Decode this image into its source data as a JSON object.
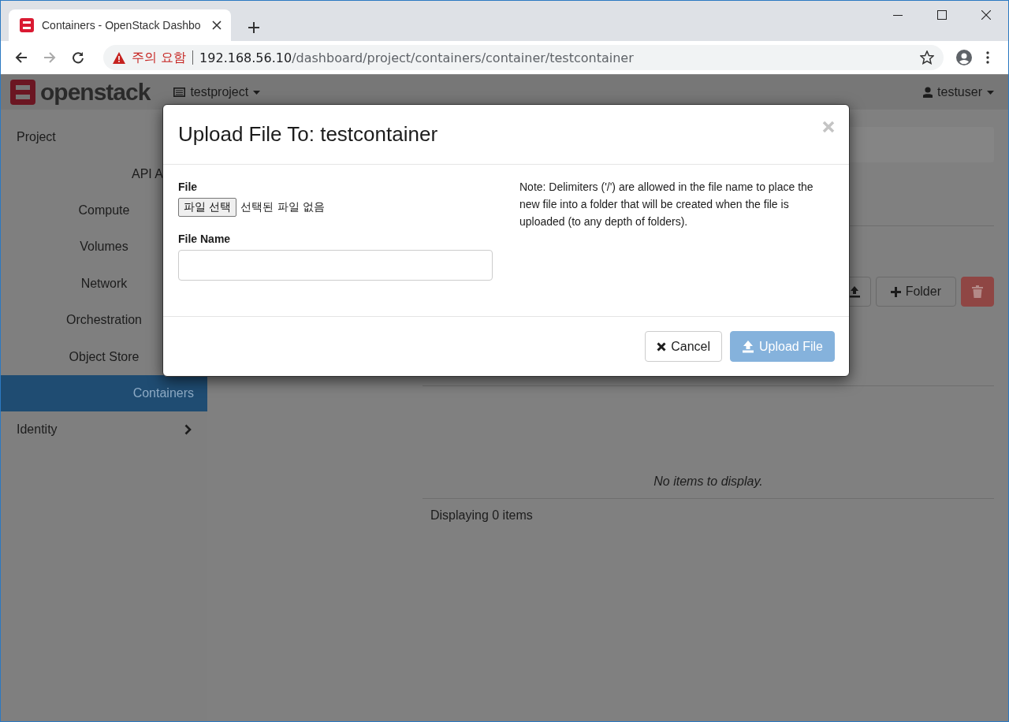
{
  "browser": {
    "tab_title": "Containers - OpenStack Dashbo",
    "security_label": "주의 요함",
    "url_host": "192.168.56.10",
    "url_path": "/dashboard/project/containers/container/testcontainer"
  },
  "navbar": {
    "logo_text": "openstack",
    "project": "testproject",
    "user": "testuser"
  },
  "sidebar": {
    "items": [
      {
        "label": "Project",
        "kind": "header",
        "selected": false
      },
      {
        "label": "API A",
        "kind": "link",
        "selected": false
      },
      {
        "label": "Compute",
        "kind": "section",
        "selected": false
      },
      {
        "label": "Volumes",
        "kind": "section",
        "selected": false
      },
      {
        "label": "Network",
        "kind": "section",
        "selected": false
      },
      {
        "label": "Orchestration",
        "kind": "section",
        "selected": false
      },
      {
        "label": "Object Store",
        "kind": "section",
        "selected": false
      },
      {
        "label": "Containers",
        "kind": "link",
        "selected": true
      },
      {
        "label": "Identity",
        "kind": "header",
        "selected": false,
        "expanded": false
      }
    ]
  },
  "content": {
    "toolbar": [
      {
        "kind": "upload"
      },
      {
        "kind": "folder",
        "label": "Folder"
      },
      {
        "kind": "delete"
      }
    ],
    "table": {
      "empty_text": "No items to display.",
      "footer": "Displaying 0 items"
    }
  },
  "modal": {
    "title": "Upload File To: testcontainer",
    "fields": [
      {
        "kind": "file",
        "label": "File",
        "button": "파일 선택",
        "status": "선택된 파일 없음"
      },
      {
        "kind": "text",
        "label": "File Name"
      }
    ],
    "note": "Note: Delimiters ('/') are allowed in the file name to place the new file into a folder that will be created when the file is uploaded (to any depth of folders).",
    "buttons": [
      {
        "kind": "cancel",
        "label": "Cancel",
        "disabled": false
      },
      {
        "kind": "upload",
        "label": "Upload File",
        "disabled": true
      }
    ]
  }
}
